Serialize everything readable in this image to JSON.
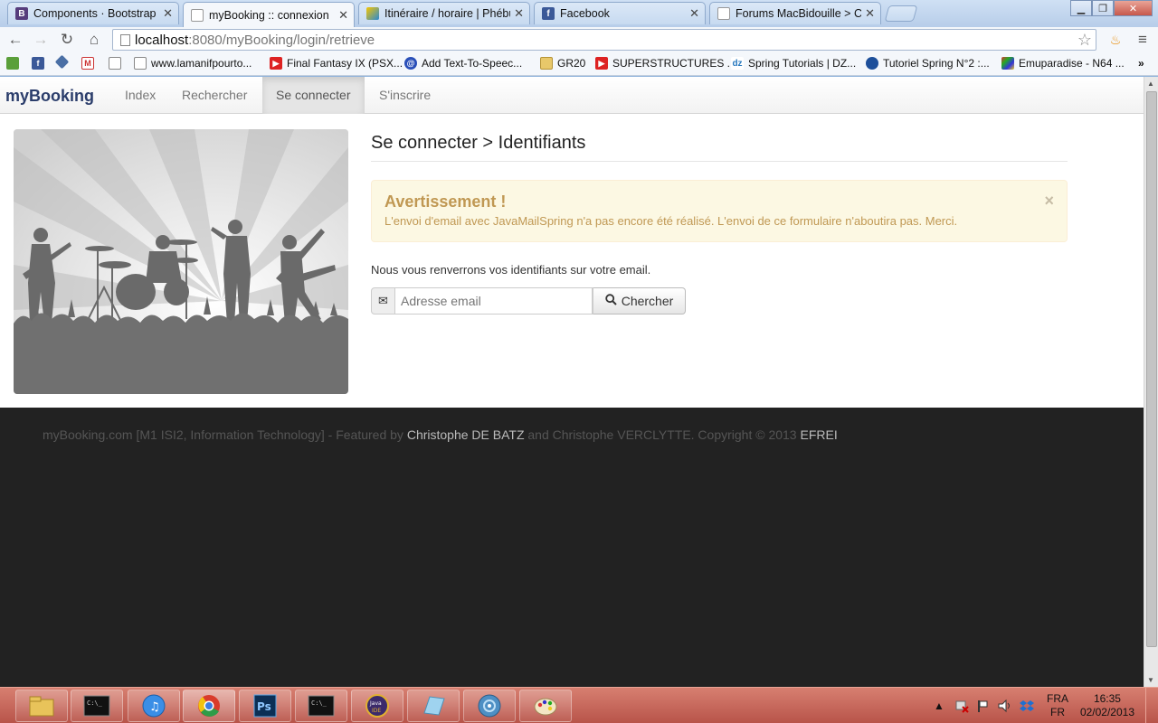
{
  "browser": {
    "tabs": [
      {
        "title": "Components · Bootstrap",
        "favicon": "bootstrap-icon",
        "active": false
      },
      {
        "title": "myBooking :: connexion",
        "favicon": "page-icon",
        "active": true
      },
      {
        "title": "Itinéraire / horaire | Phébu",
        "favicon": "phebus-icon",
        "active": false
      },
      {
        "title": "Facebook",
        "favicon": "facebook-icon",
        "active": false
      },
      {
        "title": "Forums MacBidouille > Ca",
        "favicon": "page-icon",
        "active": false
      }
    ],
    "url_host": "localhost",
    "url_path": ":8080/myBooking/login/retrieve",
    "bookmarks": [
      {
        "label": "www.lamanifpourto...",
        "icon": "page-icon"
      },
      {
        "label": "Final Fantasy IX (PSX...",
        "icon": "youtube-icon"
      },
      {
        "label": "Add Text-To-Speec...",
        "icon": "blue-circle-icon"
      },
      {
        "label": "GR20",
        "icon": "folder-icon"
      },
      {
        "label": "SUPERSTRUCTURES ...",
        "icon": "youtube-icon"
      },
      {
        "label": "Spring Tutorials | DZ...",
        "icon": "dzone-icon"
      },
      {
        "label": "Tutoriel Spring N°2 :...",
        "icon": "globe-icon"
      },
      {
        "label": "Emuparadise - N64 ...",
        "icon": "n64-icon"
      }
    ]
  },
  "site": {
    "brand": "myBooking",
    "nav": [
      {
        "label": "Index",
        "active": false
      },
      {
        "label": "Rechercher",
        "active": false
      },
      {
        "label": "Se connecter",
        "active": true
      },
      {
        "label": "S'inscrire",
        "active": false
      }
    ],
    "page_title": "Se connecter > Identifiants",
    "alert": {
      "heading": "Avertissement !",
      "message": "L'envoi d'email avec JavaMailSpring n'a pas encore été réalisé. L'envoi de ce formulaire n'aboutira pas. Merci.",
      "close": "×"
    },
    "intro": "Nous vous renverrons vos identifiants sur votre email.",
    "form": {
      "placeholder": "Adresse email",
      "button": "Chercher"
    },
    "footer": {
      "part1": "myBooking.com [M1 ISI2, Information Technology] - Featured by ",
      "author1": "Christophe DE BATZ",
      "part2": " and Christophe VERCLYTTE. Copyright © 2013 ",
      "school": "EFREI"
    }
  },
  "taskbar": {
    "apps": [
      "explorer-icon",
      "cmd-icon",
      "itunes-icon",
      "chrome-icon",
      "photoshop-icon",
      "cmd-icon",
      "java-ee-ide-icon",
      "notepad-icon",
      "disk-icon",
      "paint-icon"
    ],
    "lang_top": "FRA",
    "lang_bottom": "FR",
    "time": "16:35",
    "date": "02/02/2013"
  },
  "colors": {
    "brand": "#2b3d6b",
    "alert_bg": "#fcf8e3",
    "alert_text": "#c09853",
    "footer_bg": "#222222"
  }
}
